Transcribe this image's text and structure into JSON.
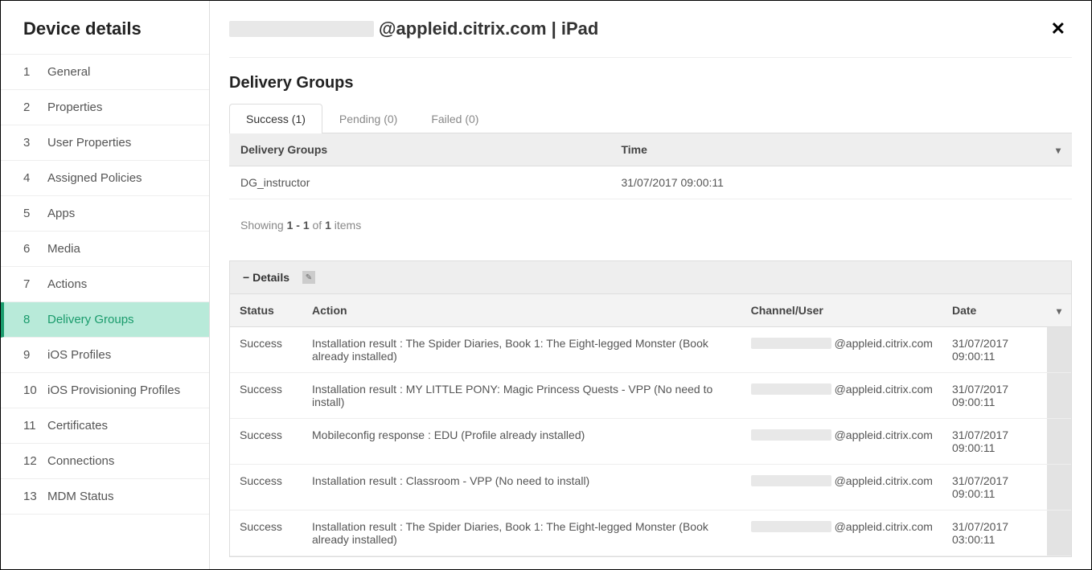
{
  "sidebar": {
    "title": "Device details",
    "items": [
      {
        "num": "1",
        "label": "General"
      },
      {
        "num": "2",
        "label": "Properties"
      },
      {
        "num": "3",
        "label": "User Properties"
      },
      {
        "num": "4",
        "label": "Assigned Policies"
      },
      {
        "num": "5",
        "label": "Apps"
      },
      {
        "num": "6",
        "label": "Media"
      },
      {
        "num": "7",
        "label": "Actions"
      },
      {
        "num": "8",
        "label": "Delivery Groups"
      },
      {
        "num": "9",
        "label": "iOS Profiles"
      },
      {
        "num": "10",
        "label": "iOS Provisioning Profiles"
      },
      {
        "num": "11",
        "label": "Certificates"
      },
      {
        "num": "12",
        "label": "Connections"
      },
      {
        "num": "13",
        "label": "MDM Status"
      }
    ],
    "active_index": 7
  },
  "header": {
    "title_suffix": "@appleid.citrix.com | iPad"
  },
  "section": {
    "title": "Delivery Groups",
    "tabs": [
      {
        "label": "Success (1)"
      },
      {
        "label": "Pending (0)"
      },
      {
        "label": "Failed (0)"
      }
    ],
    "active_tab": 0,
    "columns": {
      "group": "Delivery Groups",
      "time": "Time"
    },
    "rows": [
      {
        "group": "DG_instructor",
        "time": "31/07/2017 09:00:11"
      }
    ],
    "pagination": {
      "prefix": "Showing ",
      "range": "1 - 1",
      "mid": " of ",
      "total": "1",
      "suffix": " items"
    }
  },
  "details": {
    "label": "Details",
    "columns": {
      "status": "Status",
      "action": "Action",
      "user": "Channel/User",
      "date": "Date"
    },
    "rows": [
      {
        "status": "Success",
        "action": "Installation result : The Spider Diaries, Book 1: The Eight-legged Monster (Book already installed)",
        "user_suffix": "@appleid.citrix.com",
        "date": "31/07/2017 09:00:11"
      },
      {
        "status": "Success",
        "action": "Installation result : MY LITTLE PONY: Magic Princess Quests - VPP (No need to install)",
        "user_suffix": "@appleid.citrix.com",
        "date": "31/07/2017 09:00:11"
      },
      {
        "status": "Success",
        "action": "Mobileconfig response : EDU (Profile already installed)",
        "user_suffix": "@appleid.citrix.com",
        "date": "31/07/2017 09:00:11"
      },
      {
        "status": "Success",
        "action": "Installation result : Classroom - VPP (No need to install)",
        "user_suffix": "@appleid.citrix.com",
        "date": "31/07/2017 09:00:11"
      },
      {
        "status": "Success",
        "action": "Installation result : The Spider Diaries, Book 1: The Eight-legged Monster (Book already installed)",
        "user_suffix": "@appleid.citrix.com",
        "date": "31/07/2017 03:00:11"
      }
    ]
  }
}
